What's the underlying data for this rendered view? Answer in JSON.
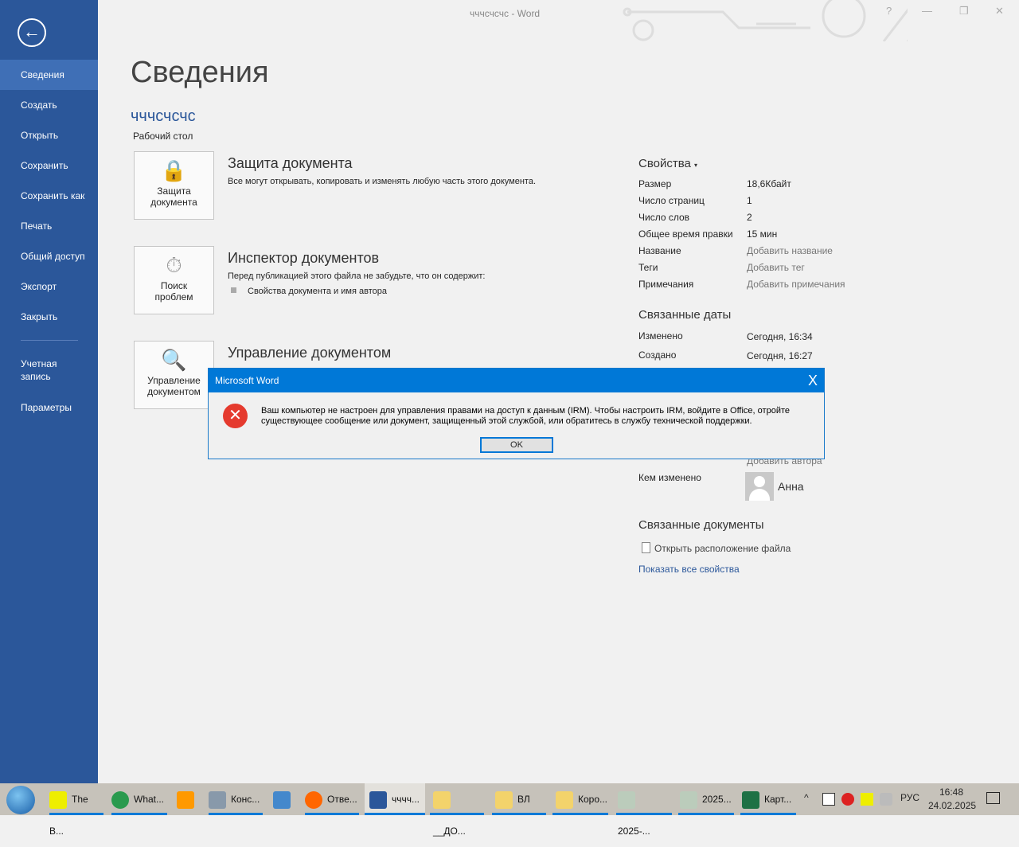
{
  "window": {
    "title": "чччсчсчс - Word",
    "help": "?",
    "minimize": "—",
    "restore": "❐",
    "close": "✕"
  },
  "sidebar": {
    "back": "←",
    "items": [
      {
        "label": "Сведения"
      },
      {
        "label": "Создать"
      },
      {
        "label": "Открыть"
      },
      {
        "label": "Сохранить"
      },
      {
        "label": "Сохранить как"
      },
      {
        "label": "Печать"
      },
      {
        "label": "Общий доступ"
      },
      {
        "label": "Экспорт"
      },
      {
        "label": "Закрыть"
      }
    ],
    "account": "Учетная запись",
    "options": "Параметры"
  },
  "main": {
    "title": "Сведения",
    "doc_name": "чччсчсчс",
    "doc_location": "Рабочий стол",
    "sections": [
      {
        "button": "Защита документа",
        "title": "Защита документа",
        "desc": "Все могут открывать, копировать и изменять любую часть этого документа."
      },
      {
        "button": "Поиск проблем",
        "title": "Инспектор документов",
        "desc": "Перед публикацией этого файла не забудьте, что он содержит:",
        "bullet": "Свойства документа и имя автора"
      },
      {
        "button": "Управление документом",
        "title": "Управление документом"
      }
    ]
  },
  "properties": {
    "header": "Свойства",
    "rows": [
      {
        "label": "Размер",
        "value": "18,6Кбайт"
      },
      {
        "label": "Число страниц",
        "value": "1"
      },
      {
        "label": "Число слов",
        "value": "2"
      },
      {
        "label": "Общее время правки",
        "value": "15 мин"
      },
      {
        "label": "Название",
        "value": "Добавить название"
      },
      {
        "label": "Теги",
        "value": "Добавить тег"
      },
      {
        "label": "Примечания",
        "value": "Добавить примечания"
      }
    ],
    "dates_header": "Связанные даты",
    "modified_label": "Изменено",
    "modified": "Сегодня, 16:34",
    "created_label": "Создано",
    "created": "Сегодня, 16:27",
    "add_author": "Добавить автора",
    "modified_by_label": "Кем изменено",
    "modified_by": "Анна",
    "related_docs_header": "Связанные документы",
    "open_location": "Открыть расположение файла",
    "show_all": "Показать все свойства"
  },
  "dialog": {
    "title": "Microsoft Word",
    "close": "X",
    "message": "Ваш компьютер не настроен для управления правами на доступ к данным (IRM). Чтобы настроить IRM, войдите в Office, отройте существующее сообщение или документ, защищенный этой службой, или обратитесь в службу технической поддержки.",
    "ok": "OK"
  },
  "taskbar": {
    "items": [
      "The B...",
      "What...",
      "",
      "Конс...",
      "",
      "Отве...",
      "чччч...",
      "__ДО...",
      "ВЛ",
      "Коро...",
      "2025-...",
      "2025...",
      "Карт..."
    ],
    "lang": "РУС",
    "time": "16:48",
    "date": "24.02.2025"
  }
}
